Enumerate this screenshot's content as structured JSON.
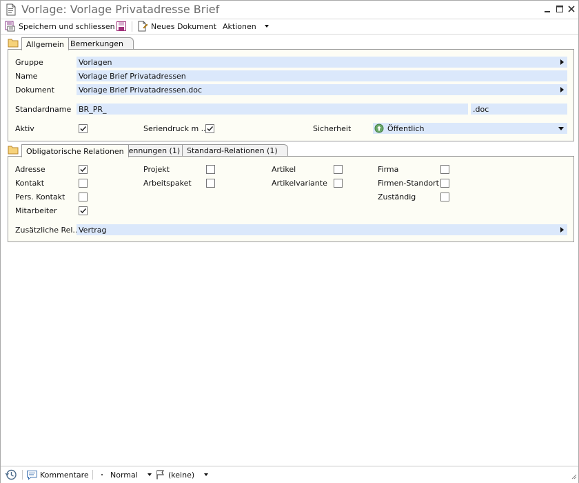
{
  "window": {
    "title": "Vorlage: Vorlage Privatadresse Brief"
  },
  "toolbar": {
    "save_close_label": "Speichern und schliessen",
    "new_document_label": "Neues Dokument",
    "actions_label": "Aktionen"
  },
  "tabs_top": [
    {
      "label": "Allgemein",
      "active": true
    },
    {
      "label": "Bemerkungen",
      "active": false
    }
  ],
  "general": {
    "gruppe_label": "Gruppe",
    "gruppe_value": "Vorlagen",
    "name_label": "Name",
    "name_value": "Vorlage Brief Privatadressen",
    "dokument_label": "Dokument",
    "dokument_value": "Vorlage Brief Privatadressen.doc",
    "standardname_label": "Standardname",
    "standardname_value": "BR_PR_",
    "extension_value": ".doc",
    "aktiv_label": "Aktiv",
    "aktiv_checked": true,
    "seriendruck_label": "Seriendruck m ...",
    "seriendruck_checked": true,
    "sicherheit_label": "Sicherheit",
    "sicherheit_value": "Öffentlich"
  },
  "tabs_bottom": [
    {
      "label": "Obligatorische Relationen",
      "active": true
    },
    {
      "label": "Kennungen (1)",
      "active": false
    },
    {
      "label": "Standard-Relationen (1)",
      "active": false
    }
  ],
  "relations": {
    "adresse": {
      "label": "Adresse",
      "checked": true
    },
    "kontakt": {
      "label": "Kontakt",
      "checked": false
    },
    "pers_kontakt": {
      "label": "Pers. Kontakt",
      "checked": false
    },
    "mitarbeiter": {
      "label": "Mitarbeiter",
      "checked": true
    },
    "projekt": {
      "label": "Projekt",
      "checked": false
    },
    "arbeitspaket": {
      "label": "Arbeitspaket",
      "checked": false
    },
    "artikel": {
      "label": "Artikel",
      "checked": false
    },
    "artikelvariante": {
      "label": "Artikelvariante",
      "checked": false
    },
    "firma": {
      "label": "Firma",
      "checked": false
    },
    "firmen_standort": {
      "label": "Firmen-Standort",
      "checked": false
    },
    "zustaendig": {
      "label": "Zuständig",
      "checked": false
    },
    "zusaetzliche_label": "Zusätzliche Rel...",
    "zusaetzliche_value": "Vertrag"
  },
  "statusbar": {
    "comments_label": "Kommentare",
    "priority_label": "Normal",
    "flag_label": "(keine)"
  },
  "colors": {
    "field_bg": "#dbe8fb",
    "panel_bg": "#fdfdf5",
    "border": "#9a9a9a",
    "title_text": "#6d6d6d"
  }
}
